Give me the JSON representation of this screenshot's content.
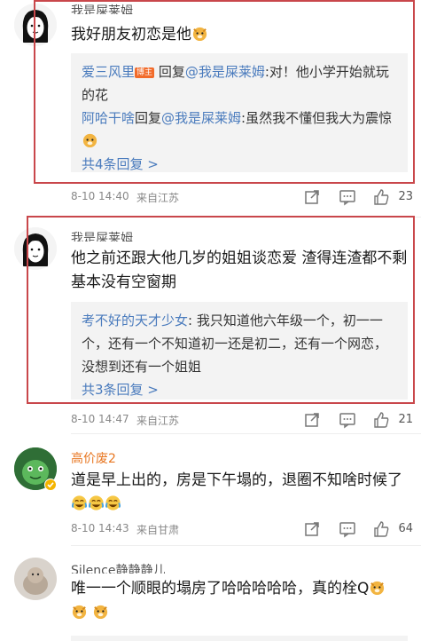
{
  "comments": [
    {
      "username": "我是屎莱姆",
      "text": "我好朋友初恋是他",
      "replies": [
        {
          "name": "爱三风里",
          "badge": "博主",
          "verb": "回复",
          "mention": "@我是屎莱姆",
          "content": ":对！他小学开始就玩的花"
        },
        {
          "name": "阿哈干啥",
          "verb": "回复",
          "mention": "@我是屎莱姆",
          "content": ":虽然我不懂但我大为震惊"
        }
      ],
      "more": "共4条回复 >",
      "time": "8-10 14:40",
      "location": "来自江苏",
      "likes": "23"
    },
    {
      "username": "我是屎莱姆",
      "text": "他之前还跟大他几岁的姐姐谈恋爱 渣得连渣都不剩 基本没有空窗期",
      "replies": [
        {
          "name": "考不好的天才少女",
          "content": ": 我只知道他六年级一个，初一一个，还有一个不知道初一还是初二，还有一个网恋，没想到还有一个姐姐"
        }
      ],
      "more": "共3条回复 >",
      "time": "8-10 14:47",
      "location": "来自江苏",
      "likes": "21"
    },
    {
      "username": "高价废2",
      "text": "道是早上出的，房是下午塌的，退圈不知啥时候了",
      "time": "8-10 14:43",
      "location": "来自甘肃",
      "likes": "64"
    },
    {
      "username": "Silence静静静儿",
      "text": "唯一一个顺眼的塌房了哈哈哈哈哈，真的栓Q",
      "time": "",
      "location": "",
      "likes": ""
    }
  ],
  "colors": {
    "link": "#4a7bbd",
    "highlight": "#c9474b",
    "reply_bg": "#f3f3f3"
  },
  "icons": [
    "share-icon",
    "comment-icon",
    "like-icon",
    "doge-emoji",
    "laugh-cry-emoji"
  ]
}
